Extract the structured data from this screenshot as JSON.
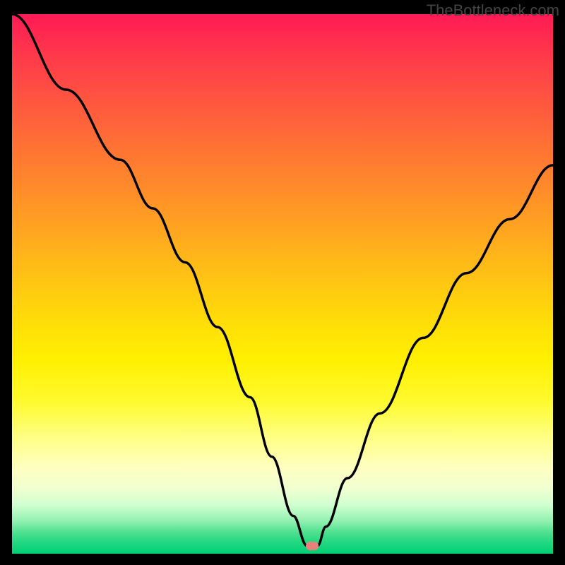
{
  "watermark": "TheBottleneck.com",
  "chart_data": {
    "type": "line",
    "title": "",
    "xlabel": "",
    "ylabel": "",
    "xlim": [
      0,
      100
    ],
    "ylim": [
      0,
      100
    ],
    "background_gradient": {
      "top": "#ff1a55",
      "bottom": "#00d075",
      "description": "red-yellow-green vertical gradient, red=high bottleneck, green=low bottleneck"
    },
    "series": [
      {
        "name": "bottleneck-curve",
        "color": "#000000",
        "x": [
          0,
          10,
          20,
          26,
          32,
          38,
          44,
          48,
          52,
          54.5,
          56.5,
          58,
          62,
          68,
          76,
          84,
          92,
          100
        ],
        "values": [
          100,
          86,
          73,
          64,
          54,
          42,
          29,
          18,
          7,
          1.5,
          1.5,
          5,
          14,
          26,
          40,
          52,
          62,
          72
        ]
      }
    ],
    "marker": {
      "x": 55.5,
      "y": 1.5,
      "color": "#e8817a"
    }
  }
}
